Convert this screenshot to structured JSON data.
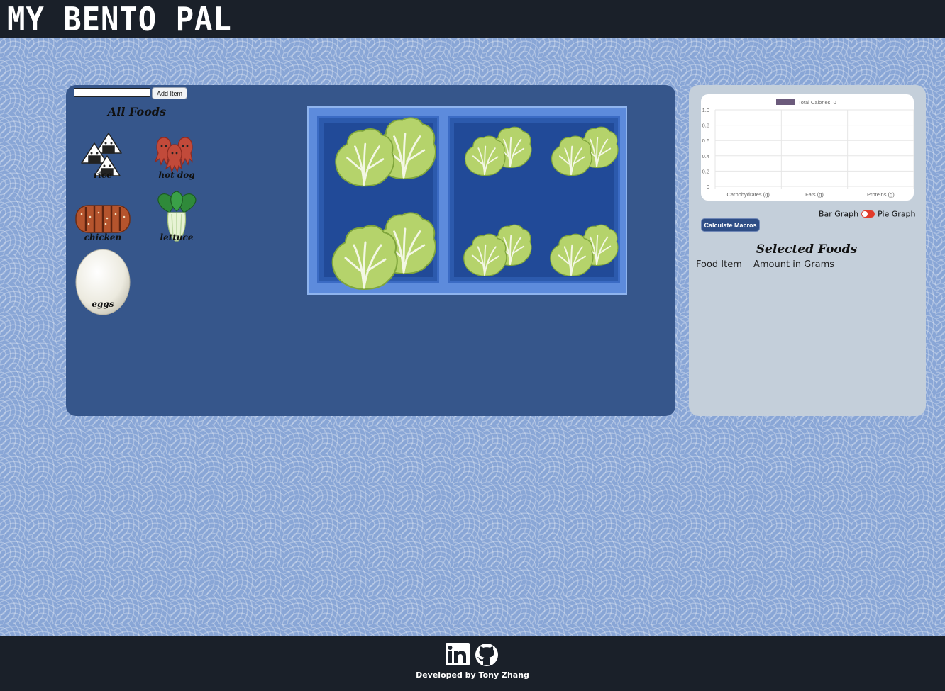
{
  "header": {
    "title": "MY BENTO PAL"
  },
  "add_item": {
    "input_value": "",
    "button_label": "Add Item"
  },
  "all_foods": {
    "title": "All Foods",
    "items": [
      {
        "label": "rice",
        "icon": "onigiri-icon"
      },
      {
        "label": "hot dog",
        "icon": "octopus-sausage-icon"
      },
      {
        "label": "chicken",
        "icon": "grilled-chicken-icon"
      },
      {
        "label": "lettuce",
        "icon": "bok-choy-icon"
      },
      {
        "label": "eggs",
        "icon": "egg-icon"
      }
    ]
  },
  "bento": {
    "contents": "lettuce",
    "colors": {
      "tray": "#5d8bdc",
      "compartment": "#214a98",
      "lettuce": "#b5d36b"
    }
  },
  "chart_data": {
    "type": "bar",
    "categories": [
      "Carbohydrates (g)",
      "Fats (g)",
      "Proteins (g)"
    ],
    "series": [
      {
        "name": "Total Calories: 0",
        "values": [
          0,
          0,
          0
        ]
      }
    ],
    "ylim": [
      0,
      1.0
    ],
    "yticks": [
      "1.0",
      "0.8",
      "0.6",
      "0.4",
      "0.2",
      "0"
    ],
    "grid": true,
    "legend": "top",
    "legend_color": "#6b5a7b"
  },
  "graph_toggle": {
    "left_label": "Bar Graph",
    "right_label": "Pie Graph"
  },
  "calculate_button": "Calculate Macros",
  "selected_foods": {
    "title": "Selected Foods",
    "col_item": "Food Item",
    "col_amount": "Amount in Grams"
  },
  "footer": {
    "credit": "Developed by Tony Zhang",
    "icons": [
      "linkedin-icon",
      "github-icon"
    ]
  }
}
